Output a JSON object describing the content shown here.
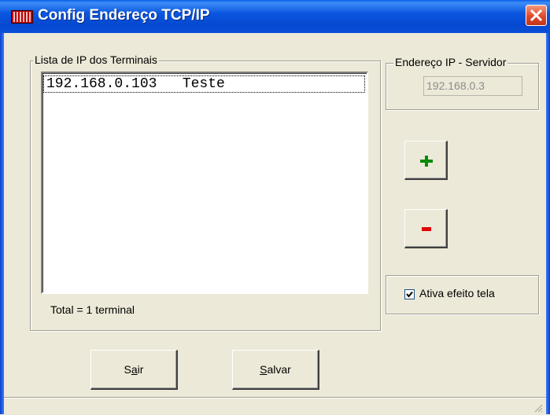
{
  "window": {
    "title": "Config Endereço TCP/IP"
  },
  "terminals_group": {
    "legend": "Lista de IP dos Terminais",
    "items": [
      {
        "ip": "192.168.0.103",
        "name": "Teste"
      }
    ],
    "item_text": "192.168.0.103   Teste",
    "total": "Total = 1 terminal"
  },
  "server_group": {
    "legend": "Endereço IP - Servidor",
    "ip": "192.168.0.3"
  },
  "actions": {
    "add_label": "+",
    "remove_label": "-"
  },
  "options": {
    "checkbox_label": "Ativa efeito tela",
    "checked": true
  },
  "buttons": {
    "sair": {
      "accel": "S",
      "underline": "a",
      "rest": "ir"
    },
    "salvar": {
      "accel": "S",
      "rest": "alvar"
    }
  },
  "colors": {
    "titlebar": "#0b57e0",
    "add": "#0a8a0a",
    "remove": "#e30000",
    "face": "#ece9d8"
  }
}
